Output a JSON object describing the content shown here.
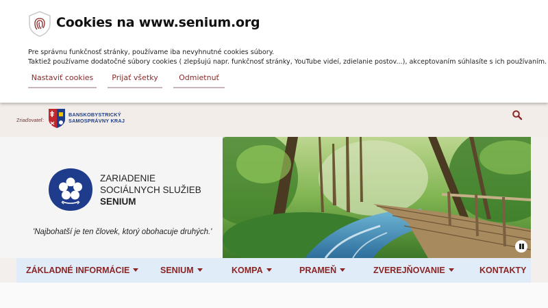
{
  "cookie": {
    "title": "Cookies na www.senium.org",
    "line1": "Pre správnu funkčnosť stránky, používame iba nevyhnutné cookies súbory.",
    "line2": "Taktiež používame dodatočné súbory cookies ( zlepšujú napr. funkčnosť stránky, YouTube videí, zdielanie postov...), akceptovaním súhlasíte s ich používaním.",
    "btn_settings": "Nastaviť cookies",
    "btn_accept": "Prijať všetky",
    "btn_reject": "Odmietnuť",
    "icon": "fingerprint-shield-icon"
  },
  "topbar": {
    "founder_label": "Zriaďovateľ:",
    "founder_line1": "BANSKOBYSTRICKÝ",
    "founder_line2": "SAMOSPRÁVNY KRAJ",
    "search_icon": "search-icon"
  },
  "org": {
    "line1": "ZARIADENIE",
    "line2": "SOCIÁLNYCH SLUŽIEB",
    "line3": "SENIUM",
    "motto": "'Najbohatší je ten človek, ktorý obohacuje druhých.'"
  },
  "nav": {
    "items": [
      {
        "label": "ZÁKLADNÉ INFORMÁCIE"
      },
      {
        "label": "SENIUM"
      },
      {
        "label": "KOMPA"
      },
      {
        "label": "PRAMEŇ"
      },
      {
        "label": "ZVEREJŇOVANIE"
      },
      {
        "label": "KONTAKTY"
      }
    ]
  },
  "colors": {
    "accent": "#8b2424",
    "nav_bg": "#e0ecf7",
    "logo_blue": "#1f3b8c"
  }
}
